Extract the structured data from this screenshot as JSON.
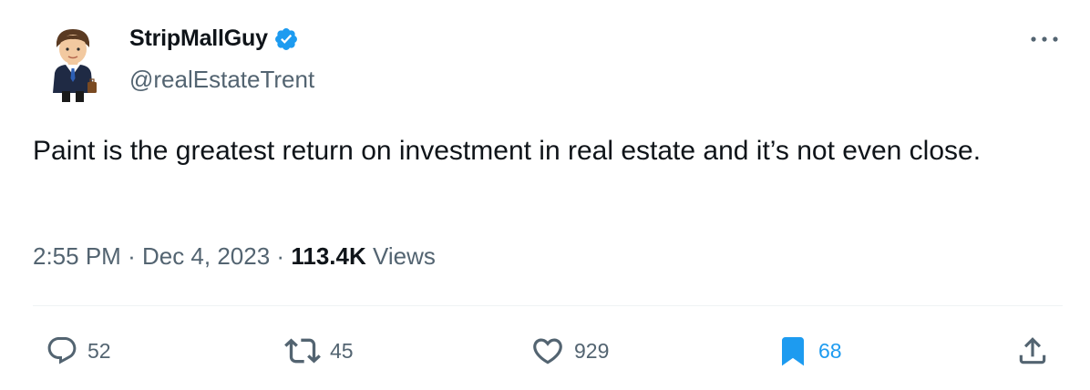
{
  "user": {
    "display_name": "StripMallGuy",
    "handle": "@realEstateTrent",
    "verified": true,
    "avatar_icon": "businessman-avatar-icon"
  },
  "tweet": {
    "text": "Paint is the greatest return on investment in real estate and it’s not even close.",
    "time": "2:55 PM",
    "separator": "·",
    "date": "Dec 4, 2023",
    "views_count": "113.4K",
    "views_label": "Views"
  },
  "actions": {
    "replies": "52",
    "retweets": "45",
    "likes": "929",
    "bookmarks": "68"
  },
  "colors": {
    "verified_blue": "#1d9bf0",
    "secondary_text": "#536471",
    "primary_text": "#0f1419",
    "divider": "#eff3f4"
  }
}
